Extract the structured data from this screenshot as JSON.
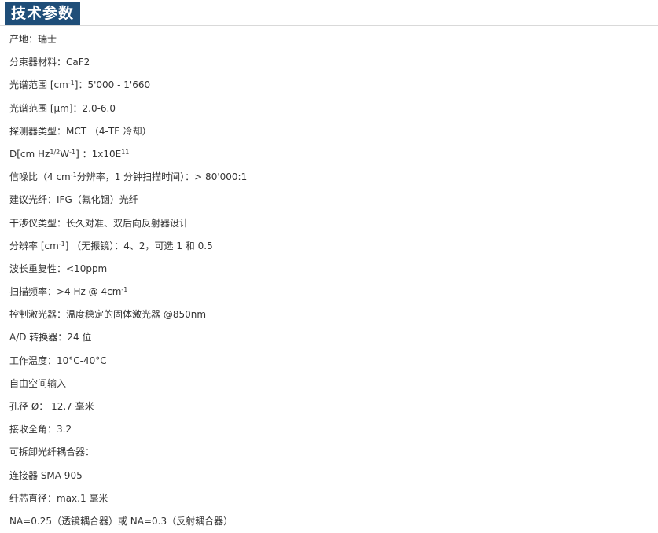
{
  "header": {
    "title": "技术参数"
  },
  "specs": {
    "origin": "产地：瑞士",
    "beamsplitter": "分束器材料：CaF2",
    "spectral_range_cm_pre": "光谱范围 [cm",
    "spectral_range_cm_sup": "-1",
    "spectral_range_cm_post": "]：5'000 - 1'660",
    "spectral_range_um": "光谱范围 [μm]：2.0-6.0",
    "detector": "探测器类型：MCT （4-TE 冷却）",
    "dstar_pre": "D[cm Hz",
    "dstar_sup1": "1/2",
    "dstar_mid": "W",
    "dstar_sup2": "-1",
    "dstar_post": "] ：1x10E",
    "dstar_sup3": "11",
    "snr_pre": "信噪比（4 cm",
    "snr_sup": "-1",
    "snr_post": "分辨率，1 分钟扫描时间）：> 80'000:1",
    "fiber": "建议光纤：IFG（氟化铟）光纤",
    "interferometer": "干涉仪类型：长久对准、双后向反射器设计",
    "resolution_pre": "分辨率 [cm",
    "resolution_sup": "-1",
    "resolution_post": "] （无振镜）：4、2，可选 1 和 0.5",
    "wavelength_repeat": "波长重复性：<10ppm",
    "scan_freq_pre": "扫描频率：>4 Hz @ 4cm",
    "scan_freq_sup": "-1",
    "control_laser": "控制激光器：温度稳定的固体激光器 @850nm",
    "adc": "A/D 转换器：24 位",
    "operating_temp": "工作温度：10°C-40°C",
    "free_space": "自由空间输入",
    "aperture": "孔径 Ø： 12.7 毫米",
    "acceptance_angle": "接收全角：3.2",
    "fiber_coupler": "可拆卸光纤耦合器：",
    "connector": "连接器 SMA 905",
    "core_diameter": "纤芯直径：max.1 毫米",
    "na": "NA=0.25（透镜耦合器）或 NA=0.3（反射耦合器）"
  }
}
